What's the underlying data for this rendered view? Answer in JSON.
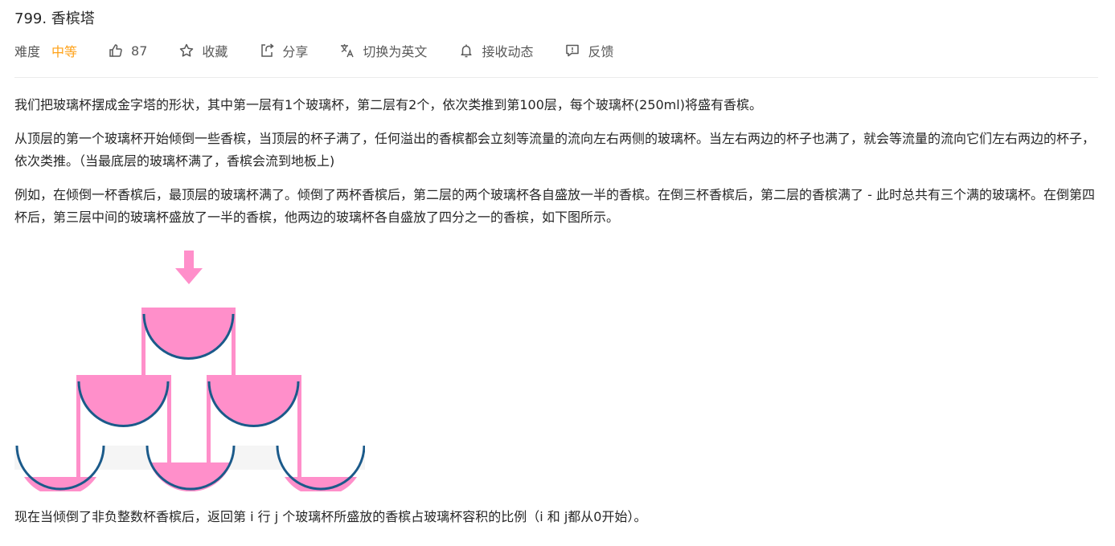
{
  "problem": {
    "title": "799. 香槟塔"
  },
  "meta": {
    "difficulty_label": "难度",
    "difficulty_value": "中等",
    "like_count": "87",
    "favorite_label": "收藏",
    "share_label": "分享",
    "switch_lang_label": "切换为英文",
    "subscribe_label": "接收动态",
    "feedback_label": "反馈",
    "icons": [
      "thumbs-up-icon",
      "star-icon",
      "share-icon",
      "translate-icon",
      "bell-icon",
      "feedback-icon"
    ],
    "accent_color": "#ffa116"
  },
  "description": {
    "paragraphs": [
      "我们把玻璃杯摆成金字塔的形状，其中第一层有1个玻璃杯，第二层有2个，依次类推到第100层，每个玻璃杯(250ml)将盛有香槟。",
      "从顶层的第一个玻璃杯开始倾倒一些香槟，当顶层的杯子满了，任何溢出的香槟都会立刻等流量的流向左右两侧的玻璃杯。当左右两边的杯子也满了，就会等流量的流向它们左右两边的杯子，依次类推。（当最底层的玻璃杯满了，香槟会流到地板上)",
      "例如，在倾倒一杯香槟后，最顶层的玻璃杯满了。倾倒了两杯香槟后，第二层的两个玻璃杯各自盛放一半的香槟。在倒三杯香槟后，第二层的香槟满了 - 此时总共有三个满的玻璃杯。在倒第四杯后，第三层中间的玻璃杯盛放了一半的香槟，他两边的玻璃杯各自盛放了四分之一的香槟，如下图所示。"
    ],
    "final_paragraph": "现在当倾倒了非负整数杯香槟后，返回第 i 行 j 个玻璃杯所盛放的香槟占玻璃杯容积的比例（i 和 j都从0开始）。"
  },
  "figure": {
    "champagne_color": "#ff8fca",
    "glass_color": "#1b5a8a",
    "rows": [
      [
        1
      ],
      [
        1,
        1
      ],
      [
        0.25,
        0.5,
        0.25
      ]
    ]
  }
}
